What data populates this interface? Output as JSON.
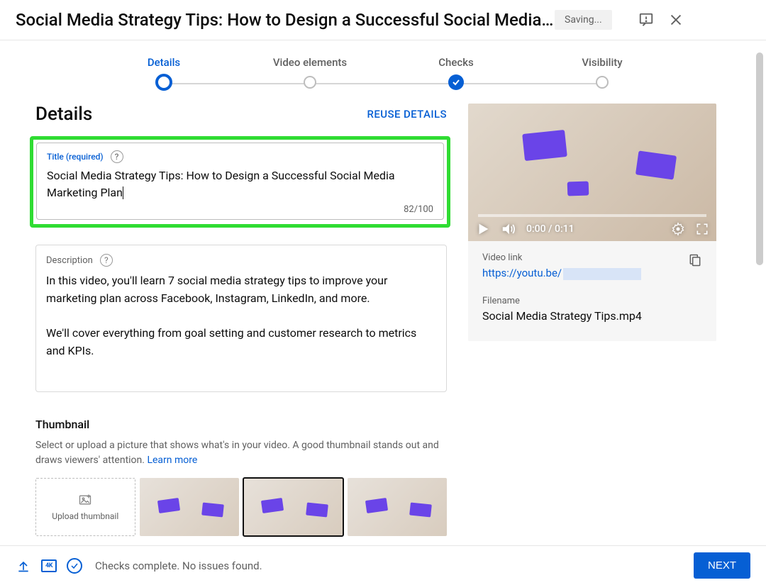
{
  "header": {
    "title_truncated": "Social Media Strategy Tips: How to Design a Successful Social Media Mar…",
    "saving": "Saving..."
  },
  "stepper": {
    "steps": [
      {
        "label": "Details",
        "state": "active"
      },
      {
        "label": "Video elements",
        "state": "pending"
      },
      {
        "label": "Checks",
        "state": "done"
      },
      {
        "label": "Visibility",
        "state": "pending"
      }
    ]
  },
  "details": {
    "section_title": "Details",
    "reuse_label": "REUSE DETAILS",
    "title_field": {
      "label": "Title (required)",
      "value": "Social Media Strategy Tips: How to Design a Successful Social Media Marketing Plan",
      "counter": "82/100"
    },
    "description_field": {
      "label": "Description",
      "value": "In this video, you'll learn 7 social media strategy tips to improve your marketing plan across Facebook, Instagram, LinkedIn, and more.\n\nWe'll cover everything from goal setting and customer research to metrics and KPIs."
    },
    "thumbnail": {
      "heading": "Thumbnail",
      "help_text": "Select or upload a picture that shows what's in your video. A good thumbnail stands out and draws viewers' attention. ",
      "learn_more": "Learn more",
      "upload_label": "Upload thumbnail",
      "selected_index": 2
    }
  },
  "preview": {
    "time": "0:00 / 0:11",
    "link_label": "Video link",
    "link_visible": "https://youtu.be/",
    "filename_label": "Filename",
    "filename": "Social Media Strategy Tips.mp4"
  },
  "footer": {
    "hd_badge": "4K",
    "checks_msg": "Checks complete. No issues found.",
    "next": "NEXT"
  }
}
